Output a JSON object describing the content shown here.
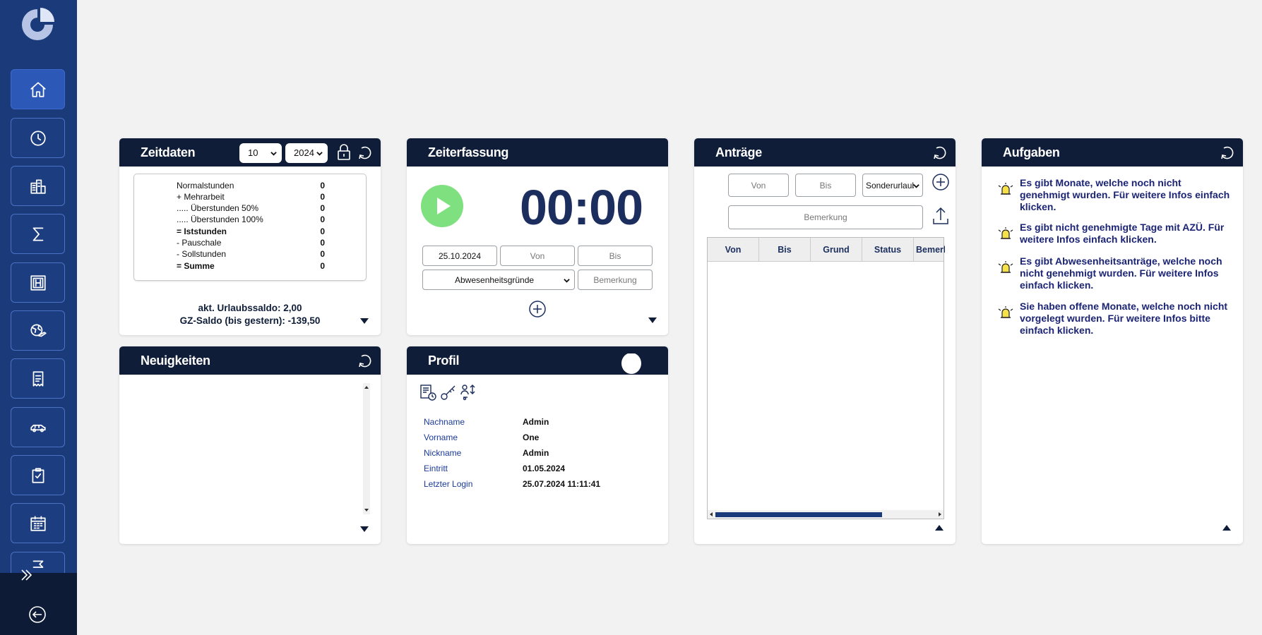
{
  "sidebar": {
    "items": [
      {
        "name": "home",
        "icon": "home-icon",
        "active": true
      },
      {
        "name": "time",
        "icon": "clock-icon"
      },
      {
        "name": "building",
        "icon": "building-icon"
      },
      {
        "name": "sum",
        "icon": "sigma-icon"
      },
      {
        "name": "schedule",
        "icon": "grid-h-icon"
      },
      {
        "name": "travel",
        "icon": "globe-plane-icon"
      },
      {
        "name": "receipt",
        "icon": "receipt-icon"
      },
      {
        "name": "car",
        "icon": "car-icon"
      },
      {
        "name": "checklist",
        "icon": "clipboard-check-icon"
      },
      {
        "name": "calendar",
        "icon": "calendar-icon"
      },
      {
        "name": "flag",
        "icon": "flag-icon"
      }
    ]
  },
  "zeitdaten": {
    "title": "Zeitdaten",
    "month": "10",
    "year": "2024",
    "rows": [
      {
        "label": "Normalstunden",
        "value": "0",
        "bold": false
      },
      {
        "label": "+ Mehrarbeit",
        "value": "0",
        "bold": false
      },
      {
        "label": "..... Überstunden 50%",
        "value": "0",
        "bold": false
      },
      {
        "label": "..... Überstunden 100%",
        "value": "0",
        "bold": false
      },
      {
        "label": "= Iststunden",
        "value": "0",
        "bold": true
      },
      {
        "label": "- Pauschale",
        "value": "0",
        "bold": false
      },
      {
        "label": "- Sollstunden",
        "value": "0",
        "bold": false
      },
      {
        "label": "= Summe",
        "value": "0",
        "bold": true
      }
    ],
    "urlaub": "akt. Urlaubssaldo: 2,00",
    "gz": "GZ-Saldo (bis gestern): -139,50"
  },
  "zeiterfassung": {
    "title": "Zeiterfassung",
    "time": "00:00",
    "date": "25.10.2024",
    "von_placeholder": "Von",
    "bis_placeholder": "Bis",
    "reason_select": "Abwesenheitsgründe",
    "bemerkung_placeholder": "Bemerkung"
  },
  "antraege": {
    "title": "Anträge",
    "von_placeholder": "Von",
    "bis_placeholder": "Bis",
    "type_select": "Sonderurlaub",
    "bemerkung_placeholder": "Bemerkung",
    "columns": [
      "Von",
      "Bis",
      "Grund",
      "Status",
      "Bemerkung"
    ]
  },
  "aufgaben": {
    "title": "Aufgaben",
    "tasks": [
      "Es gibt Monate, welche noch nicht genehmigt wurden. Für weitere Infos einfach klicken.",
      "Es gibt nicht genehmigte Tage mit AZÜ. Für weitere Infos einfach klicken.",
      "Es gibt Abwesenheitsanträge, welche noch nicht genehmigt wurden. Für weitere Infos einfach klicken.",
      "Sie haben offene Monate, welche noch nicht vorgelegt wurden. Für weitere Infos bitte einfach klicken."
    ]
  },
  "neuigkeiten": {
    "title": "Neuigkeiten"
  },
  "profil": {
    "title": "Profil",
    "rows": [
      {
        "label": "Nachname",
        "value": "Admin"
      },
      {
        "label": "Vorname",
        "value": "One"
      },
      {
        "label": "Nickname",
        "value": "Admin"
      },
      {
        "label": "Eintritt",
        "value": "01.05.2024"
      },
      {
        "label": "Letzter Login",
        "value": "25.07.2024 11:11:41"
      }
    ]
  },
  "colors": {
    "sidebar": "#1b3a7a",
    "header": "#0f1d38",
    "accent": "#2c58b8",
    "play": "#7ee07e",
    "task_text": "#1b2475"
  }
}
